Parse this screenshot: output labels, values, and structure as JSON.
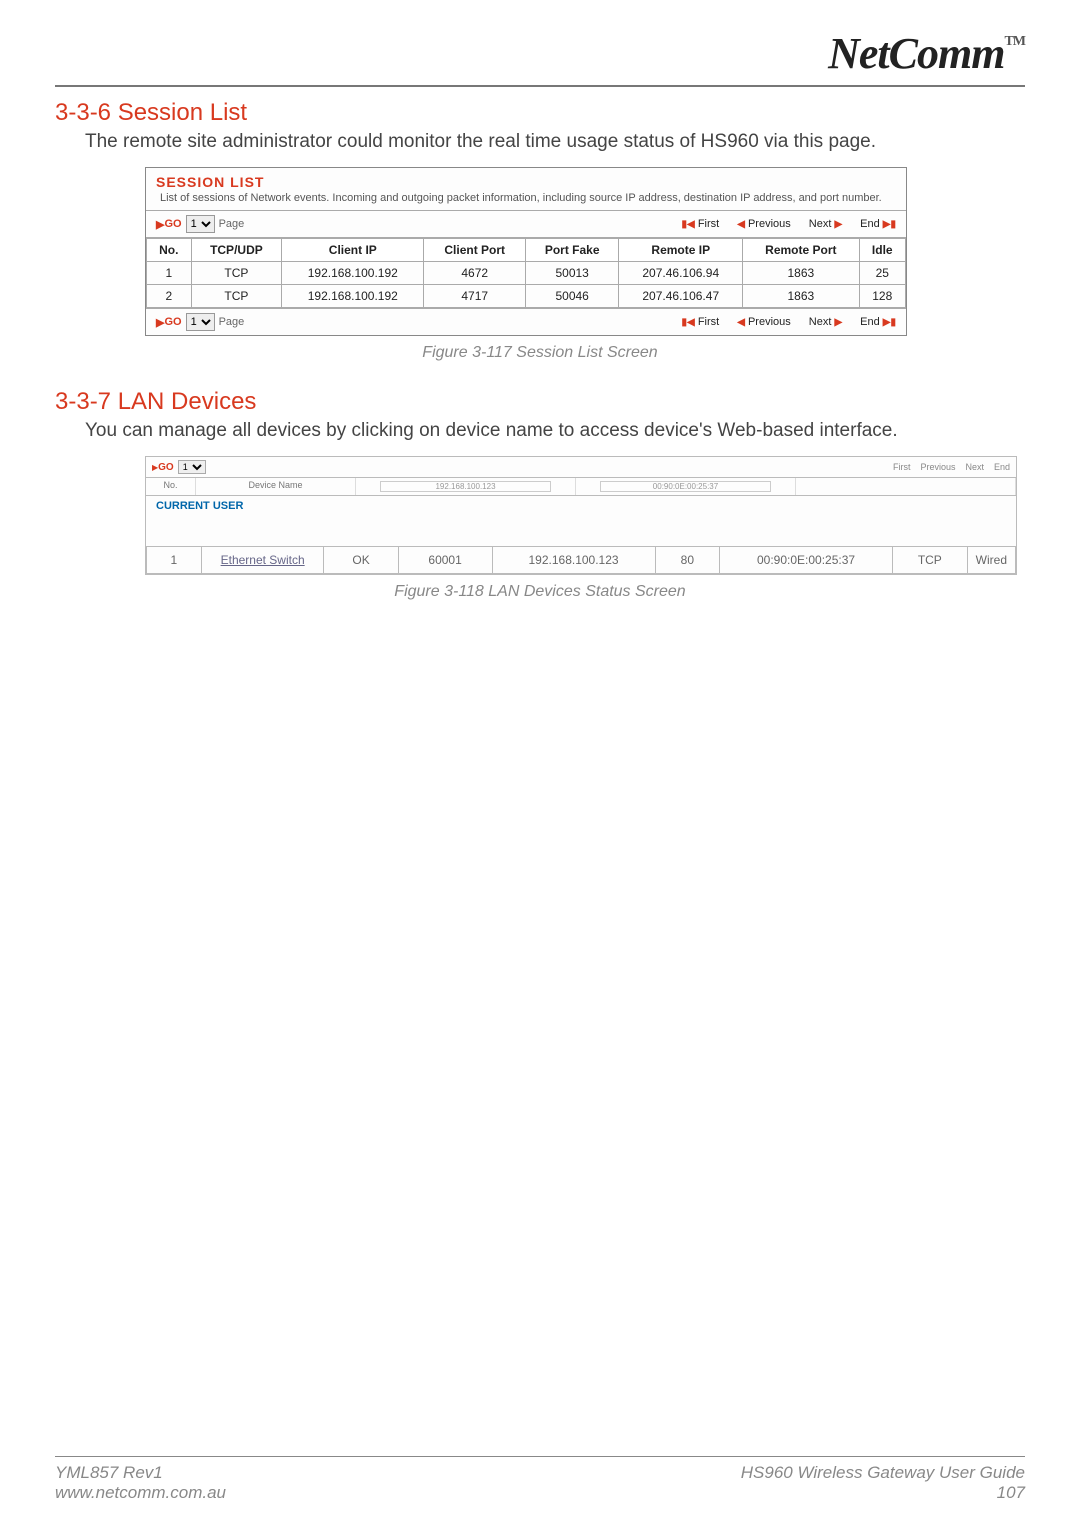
{
  "brand": {
    "name": "NetComm",
    "tm": "TM"
  },
  "section1": {
    "heading": "3-3-6 Session List",
    "body": "The remote site administrator could monitor the real time usage status of HS960 via this page.",
    "screenshot": {
      "title": "SESSION LIST",
      "desc": "List of sessions of Network events. Incoming and outgoing packet information, including source IP address, destination IP address, and port number.",
      "pager": {
        "go": "GO",
        "pageSelected": "1",
        "pageLabel": "Page",
        "first": "First",
        "previous": "Previous",
        "next": "Next",
        "end": "End"
      },
      "headers": [
        "No.",
        "TCP/UDP",
        "Client IP",
        "Client Port",
        "Port Fake",
        "Remote IP",
        "Remote Port",
        "Idle"
      ],
      "rows": [
        [
          "1",
          "TCP",
          "192.168.100.192",
          "4672",
          "50013",
          "207.46.106.94",
          "1863",
          "25"
        ],
        [
          "2",
          "TCP",
          "192.168.100.192",
          "4717",
          "50046",
          "207.46.106.47",
          "1863",
          "128"
        ]
      ]
    },
    "caption": "Figure 3-117 Session List Screen"
  },
  "section2": {
    "heading": "3-3-7 LAN Devices",
    "body": "You can manage all devices by clicking on device name to access device's Web-based interface.",
    "screenshot": {
      "topGo": "GO",
      "topSel": "1",
      "topNav": [
        "First",
        "Previous",
        "Next",
        "End"
      ],
      "hdrRow1": [
        "No.",
        "Device Name",
        "192.168.100.123",
        "00:90:0E:00:25:37",
        ""
      ],
      "current": "CURRENT USER",
      "row": {
        "no": "1",
        "link": "Ethernet Switch",
        "status": "OK",
        "port": "60001",
        "ip": "192.168.100.123",
        "http": "80",
        "mac": "00:90:0E:00:25:37",
        "proto": "TCP",
        "type": "Wired"
      }
    },
    "caption": "Figure 3-118 LAN Devices Status Screen"
  },
  "footer": {
    "leftTop": "YML857 Rev1",
    "leftBottom": "www.netcomm.com.au",
    "rightTop": "HS960 Wireless Gateway User Guide",
    "rightBottom": "107"
  }
}
